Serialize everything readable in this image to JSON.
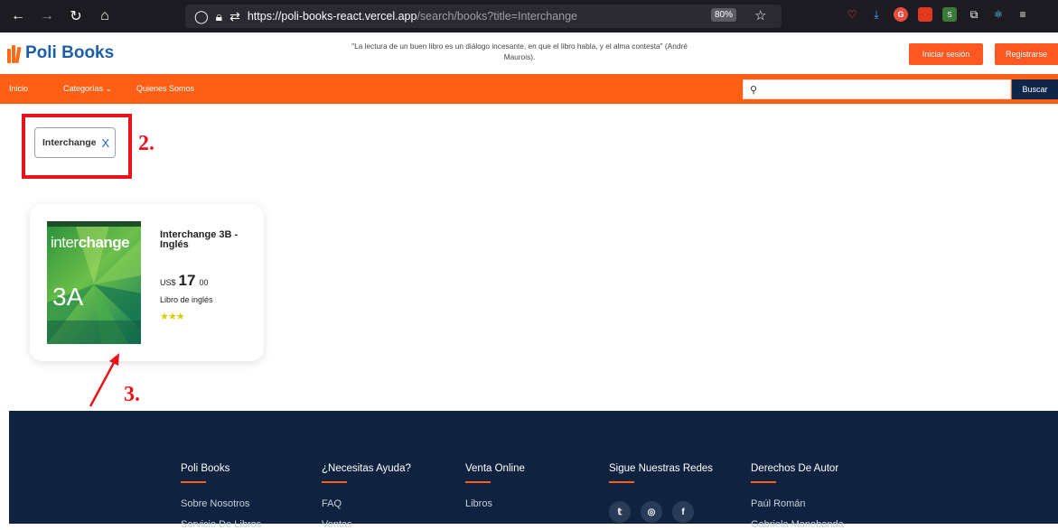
{
  "browser": {
    "url_domain": "https://poli-books-react.vercel.app",
    "url_path": "/search/books?title=Interchange",
    "zoom": "80%"
  },
  "header": {
    "logo_text": "Poli Books",
    "quote": "\"La lectura de un buen libro es un diálogo incesante, en que el libro habla, y el alma contesta\" (André Maurois).",
    "login_label": "Iniciar sesión",
    "register_label": "Registrarse"
  },
  "nav": {
    "items": [
      "Inicio",
      "Categorías",
      "Quienes Somos"
    ],
    "search_placeholder": "",
    "search_button": "Buscar"
  },
  "filter": {
    "chip_label": "Interchange",
    "chip_close": "X"
  },
  "annotations": {
    "label2": "2.",
    "label3": "3.",
    "color": "#e8141c"
  },
  "product": {
    "cover_brand_light": "inter",
    "cover_brand_bold": "change",
    "cover_level": "3A",
    "title": "Interchange 3B - Inglés",
    "currency": "US$",
    "price_int": "17",
    "price_dec": "00",
    "category": "Libro de inglés",
    "rating": 3
  },
  "footer": {
    "columns": [
      {
        "title": "Poli Books",
        "link": "Sobre Nosotros",
        "link2": "Servicio De Libros"
      },
      {
        "title": "¿Necesitas Ayuda?",
        "link": "FAQ",
        "link2": "Ventas"
      },
      {
        "title": "Venta Online",
        "link": "Libros",
        "link2": ""
      },
      {
        "title": "Sigue Nuestras Redes",
        "link": "",
        "link2": ""
      },
      {
        "title": "Derechos De Autor",
        "link": "Paúl Román",
        "link2": "Gabriela Manobanda"
      }
    ]
  },
  "colors": {
    "brand_orange": "#ff5f15",
    "brand_blue": "#1b5fa8",
    "footer_bg": "#0f2340"
  }
}
